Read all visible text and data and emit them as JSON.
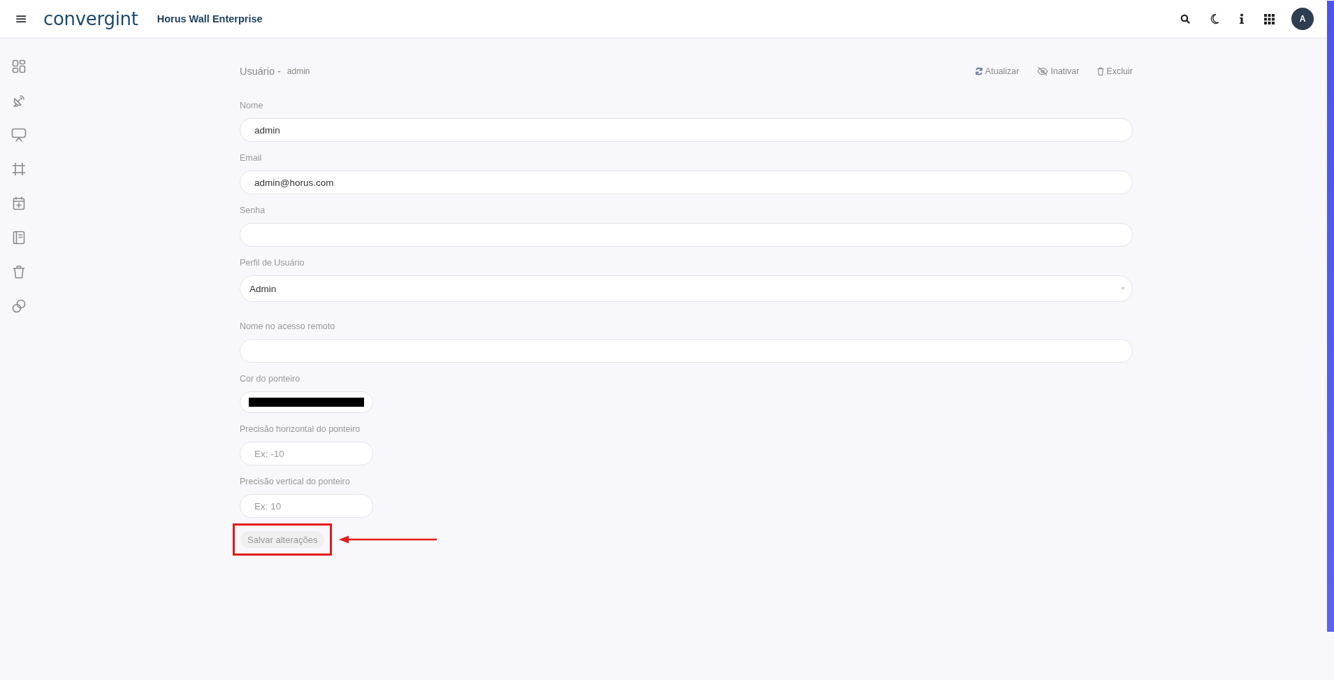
{
  "header": {
    "logo": "convergint",
    "app_title": "Horus Wall Enterprise",
    "menu_icon": "≡",
    "avatar": "A",
    "actions": [
      {
        "kind": "search"
      },
      {
        "kind": "moon"
      },
      {
        "kind": "info"
      },
      {
        "kind": "apps"
      }
    ]
  },
  "sidebar": {
    "items": [
      {
        "kind": "layout"
      },
      {
        "kind": "satellite"
      },
      {
        "kind": "monitor"
      },
      {
        "kind": "frame"
      },
      {
        "kind": "calendar"
      },
      {
        "kind": "notebook"
      },
      {
        "kind": "trash"
      },
      {
        "kind": "overlap"
      }
    ]
  },
  "page": {
    "title": "Usuário -",
    "subtitle": "admin",
    "actions": [
      {
        "kind": "refresh",
        "label": "Atualizar"
      },
      {
        "kind": "eye-off",
        "label": "Inativar"
      },
      {
        "kind": "trash",
        "label": "Excluir"
      }
    ]
  },
  "fields": [
    {
      "kind": "text",
      "label": "Nome",
      "value": "admin"
    },
    {
      "kind": "text",
      "label": "Email",
      "value": "admin@horus.com"
    },
    {
      "kind": "text",
      "label": "Senha"
    },
    {
      "kind": "select",
      "label": "Perfil de Usuário",
      "value": "Admin"
    },
    {
      "kind": "text",
      "label": "Nome no acesso remoto"
    },
    {
      "kind": "color",
      "label": "Cor do ponteiro",
      "color": "#000000"
    },
    {
      "kind": "short",
      "label": "Precisão horizontal do ponteiro",
      "placeholder": "Ex: -10"
    },
    {
      "kind": "short",
      "label": "Precisão vertical do ponteiro",
      "placeholder": "Ex: 10"
    }
  ],
  "save_button": {
    "label": "Salvar alterações",
    "disabled": true
  },
  "annotation": {
    "highlight": true
  }
}
